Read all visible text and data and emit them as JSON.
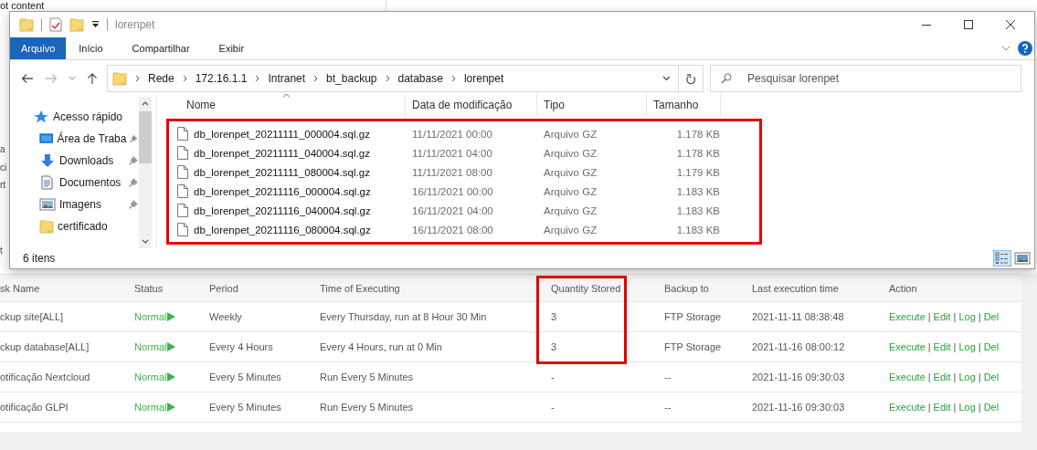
{
  "background_page": {
    "top_text": "ot content",
    "side_fragments": [
      "a",
      "ci",
      "rt",
      "t"
    ]
  },
  "explorer": {
    "title": "lorenpet",
    "ribbon_tabs": [
      {
        "label": "Arquivo",
        "selected": true
      },
      {
        "label": "Início",
        "selected": false
      },
      {
        "label": "Compartilhar",
        "selected": false
      },
      {
        "label": "Exibir",
        "selected": false
      }
    ],
    "breadcrumb": [
      "Rede",
      "172.16.1.1",
      "Intranet",
      "bt_backup",
      "database",
      "lorenpet"
    ],
    "search": {
      "placeholder": "Pesquisar lorenpet"
    },
    "nav_items": [
      {
        "label": "Acesso rápido",
        "kind": "quick-access",
        "pinned": false
      },
      {
        "label": "Área de Traba",
        "kind": "desktop",
        "pinned": true
      },
      {
        "label": "Downloads",
        "kind": "downloads",
        "pinned": true
      },
      {
        "label": "Documentos",
        "kind": "documents",
        "pinned": true
      },
      {
        "label": "Imagens",
        "kind": "images",
        "pinned": true
      },
      {
        "label": "certificado",
        "kind": "folder",
        "pinned": false
      }
    ],
    "file_list": {
      "highlight": true,
      "columns": [
        "Nome",
        "Data de modificação",
        "Tipo",
        "Tamanho"
      ],
      "rows": [
        {
          "name": "db_lorenpet_20211111_000004.sql.gz",
          "modified": "11/11/2021 00:00",
          "type": "Arquivo GZ",
          "size": "1.178 KB"
        },
        {
          "name": "db_lorenpet_20211111_040004.sql.gz",
          "modified": "11/11/2021 04:00",
          "type": "Arquivo GZ",
          "size": "1.178 KB"
        },
        {
          "name": "db_lorenpet_20211111_080004.sql.gz",
          "modified": "11/11/2021 08:00",
          "type": "Arquivo GZ",
          "size": "1.179 KB"
        },
        {
          "name": "db_lorenpet_20211116_000004.sql.gz",
          "modified": "16/11/2021 00:00",
          "type": "Arquivo GZ",
          "size": "1.183 KB"
        },
        {
          "name": "db_lorenpet_20211116_040004.sql.gz",
          "modified": "16/11/2021 04:00",
          "type": "Arquivo GZ",
          "size": "1.183 KB"
        },
        {
          "name": "db_lorenpet_20211116_080004.sql.gz",
          "modified": "16/11/2021 08:00",
          "type": "Arquivo GZ",
          "size": "1.183 KB"
        }
      ]
    },
    "status_bar": "6 itens"
  },
  "task_table": {
    "columns": [
      {
        "label": "sk Name",
        "highlight": false
      },
      {
        "label": "Status",
        "highlight": false
      },
      {
        "label": "Period",
        "highlight": false
      },
      {
        "label": "Time of Executing",
        "highlight": false
      },
      {
        "label": "Quantity Stored",
        "highlight": true
      },
      {
        "label": "Backup to",
        "highlight": false
      },
      {
        "label": "Last execution time",
        "highlight": false
      },
      {
        "label": "Action",
        "highlight": false
      }
    ],
    "action_separator": "|",
    "rows": [
      {
        "task_name": "ckup site[ALL]",
        "status": "Normal",
        "period": "Weekly",
        "time_of_executing": "Every Thursday, run at 8 Hour 30 Min",
        "quantity_stored": "3",
        "backup_to": "FTP Storage",
        "last_execution_time": "2021-11-11 08:38:48",
        "actions": [
          "Execute",
          "Edit",
          "Log",
          "Del"
        ]
      },
      {
        "task_name": "ckup database[ALL]",
        "status": "Normal",
        "period": "Every 4 Hours",
        "time_of_executing": "Every 4 Hours, run at 0 Min",
        "quantity_stored": "3",
        "backup_to": "FTP Storage",
        "last_execution_time": "2021-11-16 08:00:12",
        "actions": [
          "Execute",
          "Edit",
          "Log",
          "Del"
        ]
      },
      {
        "task_name": "otificação Nextcloud",
        "status": "Normal",
        "period": "Every 5 Minutes",
        "time_of_executing": "Run Every 5 Minutes",
        "quantity_stored": "-",
        "backup_to": "--",
        "last_execution_time": "2021-11-16 09:30:03",
        "actions": [
          "Execute",
          "Edit",
          "Log",
          "Del"
        ]
      },
      {
        "task_name": "otificação GLPI",
        "status": "Normal",
        "period": "Every 5 Minutes",
        "time_of_executing": "Run Every 5 Minutes",
        "quantity_stored": "-",
        "backup_to": "--",
        "last_execution_time": "2021-11-16 09:30:03",
        "actions": [
          "Execute",
          "Edit",
          "Log",
          "Del"
        ]
      }
    ]
  }
}
